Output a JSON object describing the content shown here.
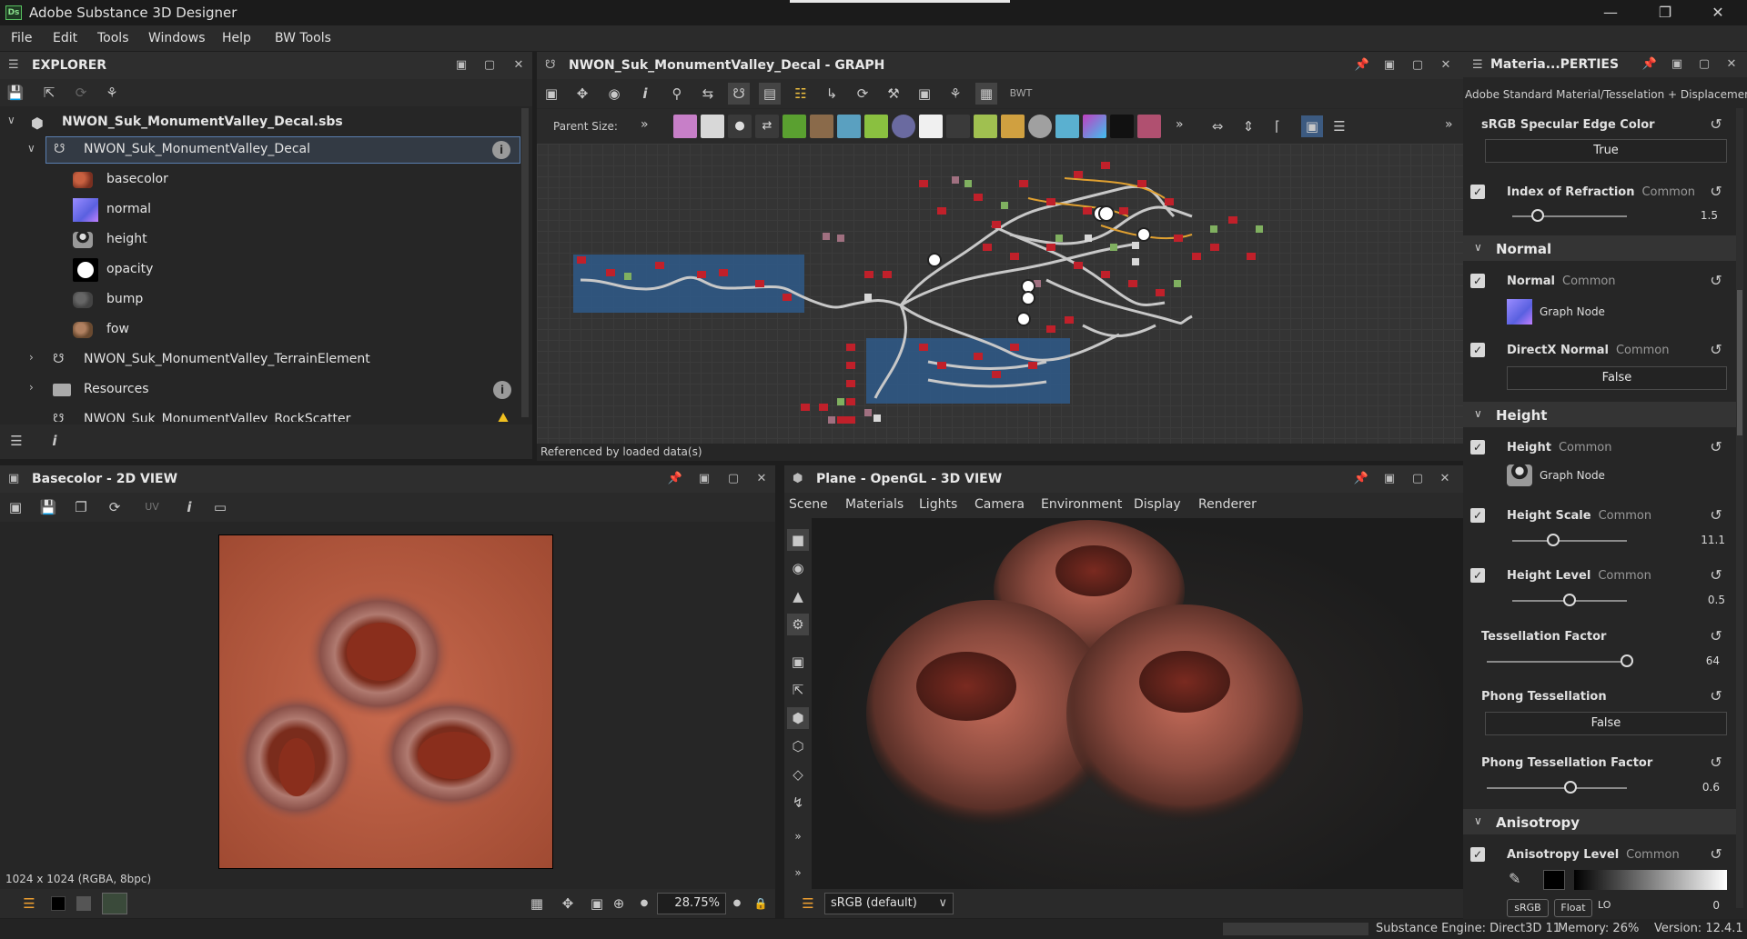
{
  "app": {
    "title": "Adobe Substance 3D Designer",
    "logo_text": "Ds"
  },
  "menu": [
    "File",
    "Edit",
    "Tools",
    "Windows",
    "Help",
    "BW Tools"
  ],
  "explorer": {
    "title": "EXPLORER",
    "package": "NWON_Suk_MonumentValley_Decal.sbs",
    "selected_graph": "NWON_Suk_MonumentValley_Decal",
    "outputs": [
      "basecolor",
      "normal",
      "height",
      "opacity",
      "bump",
      "fow"
    ],
    "other_items": [
      "NWON_Suk_MonumentValley_TerrainElement",
      "Resources",
      "NWON_Suk_MonumentValley_RockScatter"
    ]
  },
  "graph": {
    "title": "NWON_Suk_MonumentValley_Decal - GRAPH",
    "parent_size_label": "Parent Size:",
    "bwt_label": "BWT",
    "footer": "Referenced by loaded data(s)"
  },
  "view2d": {
    "title": "Basecolor - 2D VIEW",
    "uv_label": "UV",
    "image_info": "1024 x 1024 (RGBA, 8bpc)",
    "zoom": "28.75%"
  },
  "view3d": {
    "title": "Plane - OpenGL - 3D VIEW",
    "tabs": [
      "Scene",
      "Materials",
      "Lights",
      "Camera",
      "Environment",
      "Display",
      "Renderer"
    ],
    "colorspace": "sRGB (default)"
  },
  "properties": {
    "title": "Materia...PERTIES",
    "subtitle": "Adobe Standard Material/Tesselation + Displacement",
    "common": "Common",
    "graph_node": "Graph Node",
    "specular_edge": {
      "label": "sRGB Specular Edge Color",
      "value": "True"
    },
    "ior": {
      "label": "Index of Refraction",
      "value": "1.5",
      "fraction": 0.22
    },
    "normal_section": "Normal",
    "normal": {
      "label": "Normal"
    },
    "directx": {
      "label": "DirectX Normal",
      "value": "False"
    },
    "height_section": "Height",
    "height": {
      "label": "Height"
    },
    "height_scale": {
      "label": "Height Scale",
      "value": "11.1",
      "fraction": 0.36
    },
    "height_level": {
      "label": "Height Level",
      "value": "0.5",
      "fraction": 0.5
    },
    "tess_factor": {
      "label": "Tessellation Factor",
      "value": "64",
      "fraction": 1.0
    },
    "phong": {
      "label": "Phong Tessellation",
      "value": "False"
    },
    "phong_factor": {
      "label": "Phong Tessellation Factor",
      "value": "0.6",
      "fraction": 0.6
    },
    "aniso_section": "Anisotropy",
    "aniso": {
      "label": "Anisotropy Level",
      "value": "0",
      "srgb": "sRGB",
      "float": "Float",
      "lo": "LO"
    }
  },
  "status": {
    "engine": "Substance Engine: Direct3D 11",
    "memory": "Memory: 26%",
    "version": "Version: 12.4.1"
  },
  "colors": {
    "accent": "#5a7fb0",
    "frame_blue": "#2f5a8a",
    "basecolor": "#b85a40",
    "warn": "#f0c020"
  }
}
